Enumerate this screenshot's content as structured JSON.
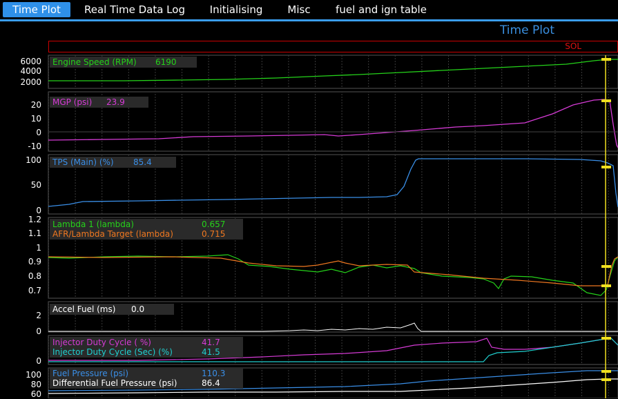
{
  "tabs": [
    {
      "label": "Time Plot",
      "active": true
    },
    {
      "label": "Real Time Data Log",
      "active": false
    },
    {
      "label": "Initialising",
      "active": false
    },
    {
      "label": "Misc",
      "active": false
    },
    {
      "label": "fuel and ign table",
      "active": false
    }
  ],
  "plot_title": "Time Plot",
  "sol_label": "SOL",
  "panels": {
    "rpm": {
      "label": "Engine Speed (RPM)",
      "value": "6190",
      "color": "#25d31a",
      "ticks": [
        "6000",
        "4000",
        "2000"
      ]
    },
    "mgp": {
      "label": "MGP (psi)",
      "value": "23.9",
      "color": "#d63bd6",
      "ticks": [
        "20",
        "10",
        "0",
        "-10"
      ]
    },
    "tps": {
      "label": "TPS (Main) (%)",
      "value": "85.4",
      "color": "#3a8fe8",
      "ticks": [
        "100",
        "50",
        "0"
      ]
    },
    "lambda": {
      "label": "Lambda 1 (lambda)",
      "value": "0.657",
      "color": "#25d31a",
      "label2": "AFR/Lambda Target (lambda)",
      "value2": "0.715",
      "color2": "#f07820",
      "ticks": [
        "1.2",
        "1.1",
        "1",
        "0.9",
        "0.8",
        "0.7"
      ]
    },
    "accel": {
      "label": "Accel Fuel (ms)",
      "value": "0.0",
      "color": "#ffffff",
      "ticks": [
        "2",
        "0"
      ]
    },
    "inj": {
      "label": "Injector Duty Cycle ( %)",
      "value": "41.7",
      "color": "#d63bd6",
      "label2": "Injector Duty Cycle (Sec) (%)",
      "value2": "41.5",
      "color2": "#20d0d0",
      "ticks": [
        "0"
      ]
    },
    "fuel": {
      "label": "Fuel Pressure (psi)",
      "value": "110.3",
      "color": "#3a8fe8",
      "label2": "Differential Fuel Pressure (psi)",
      "value2": "86.4",
      "color2": "#ffffff",
      "ticks": [
        "100",
        "80",
        "60"
      ]
    }
  },
  "cursor_color": "#f0e020"
}
